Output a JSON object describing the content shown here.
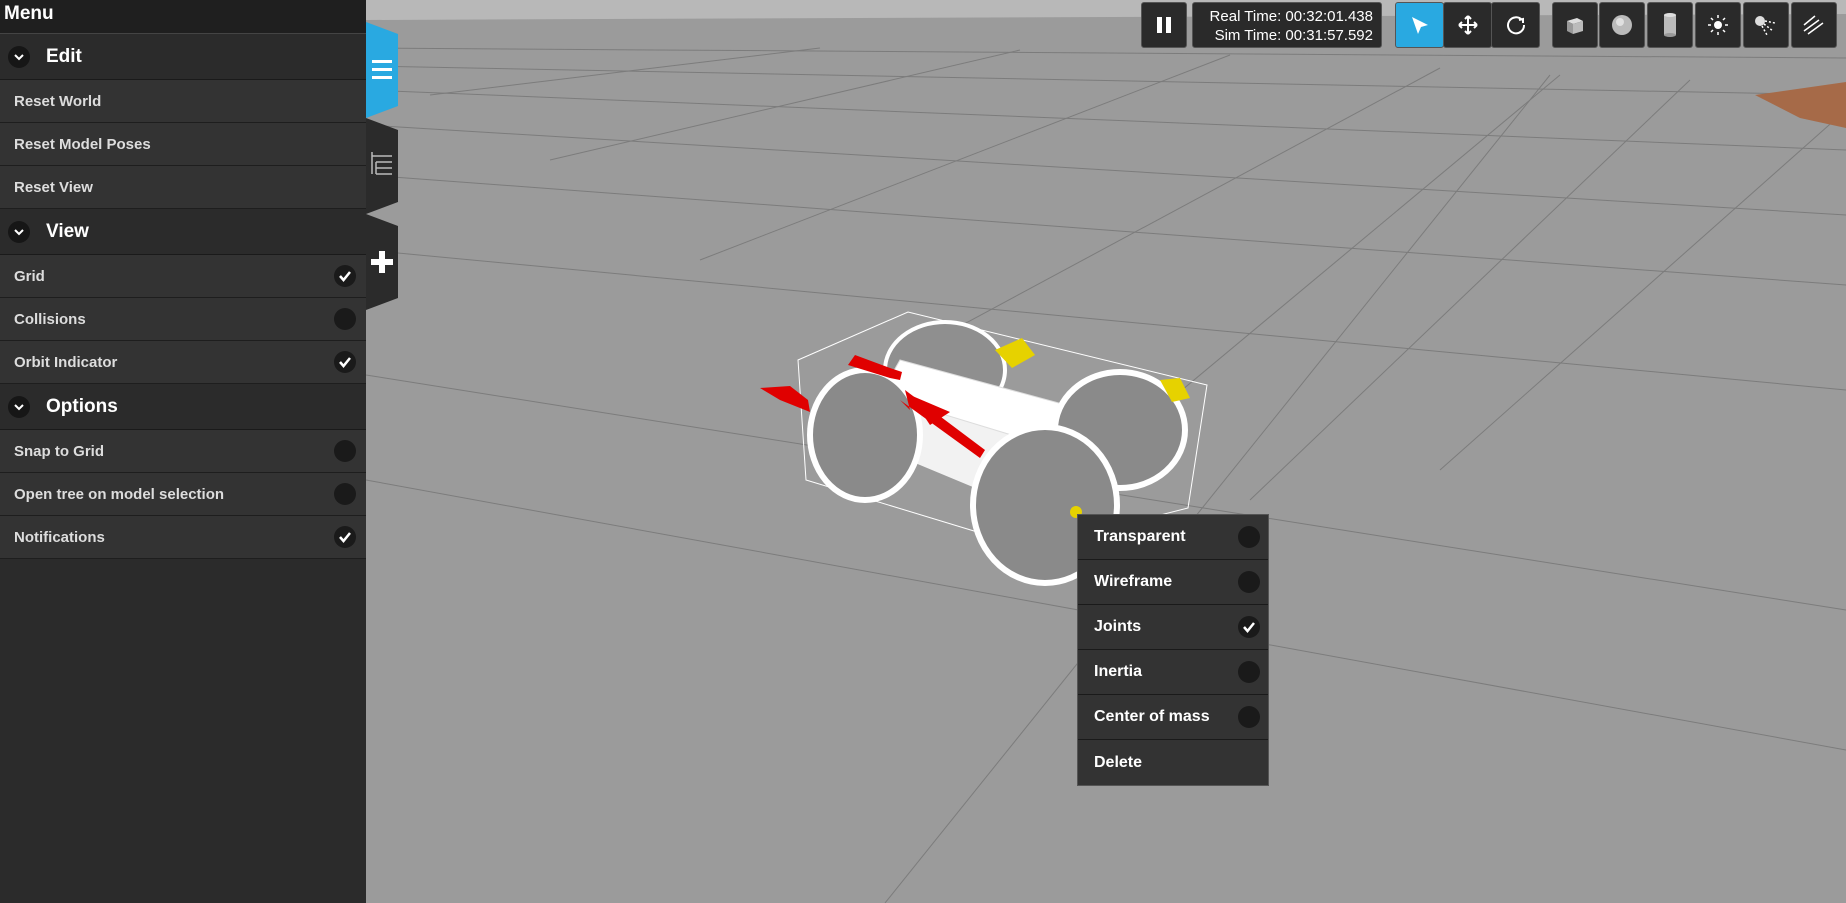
{
  "menu": {
    "title": "Menu",
    "sections": [
      {
        "label": "Edit",
        "items": [
          {
            "label": "Reset World"
          },
          {
            "label": "Reset Model Poses"
          },
          {
            "label": "Reset View"
          }
        ]
      },
      {
        "label": "View",
        "items": [
          {
            "label": "Grid",
            "checked": true
          },
          {
            "label": "Collisions",
            "checked": false
          },
          {
            "label": "Orbit Indicator",
            "checked": true
          }
        ]
      },
      {
        "label": "Options",
        "items": [
          {
            "label": "Snap to Grid",
            "checked": false
          },
          {
            "label": "Open tree on model selection",
            "checked": false
          },
          {
            "label": "Notifications",
            "checked": true
          }
        ]
      }
    ]
  },
  "side_tabs": [
    {
      "icon": "hamburger-icon",
      "active": true
    },
    {
      "icon": "tree-icon",
      "active": false
    },
    {
      "icon": "plus-icon",
      "active": false
    }
  ],
  "toolbar": {
    "pause_icon": "pause-icon",
    "real_time": "Real Time: 00:32:01.438",
    "sim_time": "Sim Time: 00:31:57.592",
    "modes": [
      {
        "icon": "select-arrow-icon",
        "active": true
      },
      {
        "icon": "translate-icon",
        "active": false
      },
      {
        "icon": "rotate-icon",
        "active": false
      }
    ],
    "shapes": [
      "box-icon",
      "sphere-icon",
      "cylinder-icon",
      "point-light-icon",
      "spot-light-icon",
      "directional-light-icon"
    ]
  },
  "context_menu": {
    "items": [
      {
        "label": "Transparent",
        "checked": false
      },
      {
        "label": "Wireframe",
        "checked": false
      },
      {
        "label": "Joints",
        "checked": true
      },
      {
        "label": "Inertia",
        "checked": false
      },
      {
        "label": "Center of mass",
        "checked": false
      }
    ],
    "delete_label": "Delete"
  },
  "colors": {
    "accent": "#29a9e1",
    "panel": "#2b2b2b",
    "ground": "#9a9a9a"
  }
}
